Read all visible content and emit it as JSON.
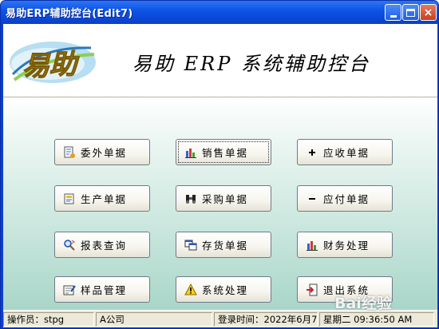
{
  "window": {
    "title": "易助ERP辅助控台(Edit7)",
    "controls": {
      "minimize": "minimize",
      "maximize": "maximize",
      "close": "×"
    }
  },
  "banner": {
    "logo_text": "易助",
    "title": "易助 ERP 系统辅助控台"
  },
  "buttons": [
    {
      "label": "委外单据",
      "icon": "document-list-icon"
    },
    {
      "label": "销售单据",
      "icon": "bar-chart-icon"
    },
    {
      "label": "应收单据",
      "icon": "plus-icon"
    },
    {
      "label": "生产单据",
      "icon": "production-icon"
    },
    {
      "label": "采购单据",
      "icon": "binoculars-icon"
    },
    {
      "label": "应付单据",
      "icon": "minus-icon"
    },
    {
      "label": "报表查询",
      "icon": "search-icon"
    },
    {
      "label": "存货单据",
      "icon": "windows-icon"
    },
    {
      "label": "财务处理",
      "icon": "bar-chart-icon"
    },
    {
      "label": "样品管理",
      "icon": "edit-form-icon"
    },
    {
      "label": "系统处理",
      "icon": "warning-icon"
    },
    {
      "label": "退出系统",
      "icon": "exit-icon"
    }
  ],
  "status": {
    "operator_label": "操作员：",
    "operator": "stpg",
    "company": "A公司",
    "login_label": "登录时间：",
    "login_date": "2022年6月7日",
    "weekday_time": "星期二 09:36:50 AM"
  },
  "watermark": "Bai经验",
  "colors": {
    "titlebar": "#0a46d6",
    "close": "#c8401e",
    "client": "#ece9d8",
    "gradient_bottom": "#a9d6c8"
  }
}
